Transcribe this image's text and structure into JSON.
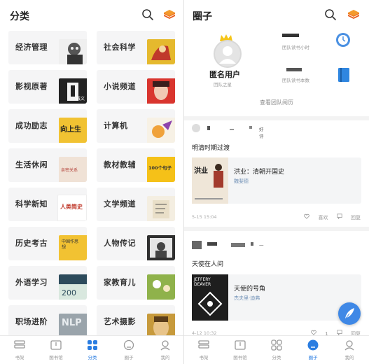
{
  "left": {
    "title": "分类",
    "categories": [
      {
        "label": "经济管理",
        "cover_color": "#efefef"
      },
      {
        "label": "社会科学",
        "cover_color": "#e5b92e"
      },
      {
        "label": "影视原著",
        "cover_color": "#222222"
      },
      {
        "label": "小说频道",
        "cover_color": "#d9352e"
      },
      {
        "label": "成功励志",
        "cover_color": "#f1c232"
      },
      {
        "label": "计算机",
        "cover_color": "#f7f1e5"
      },
      {
        "label": "生活休闲",
        "cover_color": "#f0e2d6"
      },
      {
        "label": "教材教辅",
        "cover_color": "#f5c118"
      },
      {
        "label": "科学新知",
        "cover_color": "#ffffff"
      },
      {
        "label": "文学频道",
        "cover_color": "#f4eee1"
      },
      {
        "label": "历史考古",
        "cover_color": "#f2c232"
      },
      {
        "label": "人物传记",
        "cover_color": "#2f2f2f"
      },
      {
        "label": "外语学习",
        "cover_color": "#d9e8df"
      },
      {
        "label": "家教育儿",
        "cover_color": "#8fb24b"
      },
      {
        "label": "职场进阶",
        "cover_color": "#9aa4ab"
      },
      {
        "label": "艺术摄影",
        "cover_color": "#c79a3c"
      }
    ],
    "cover_texts": {
      "ent_2": "戴文",
      "ent_4": "向上生",
      "ent_6": "亲密关系",
      "ent_7": "100个句子",
      "ent_8": "人类简史",
      "ent_10": "中国作思想",
      "ent_14": "NLP"
    },
    "nav": [
      {
        "label": "书架",
        "icon": "shelf-icon",
        "active": false
      },
      {
        "label": "图书馆",
        "icon": "library-icon",
        "active": false
      },
      {
        "label": "分类",
        "icon": "category-icon",
        "active": true
      },
      {
        "label": "圈子",
        "icon": "circle-icon",
        "active": false
      },
      {
        "label": "我的",
        "icon": "profile-icon",
        "active": false
      }
    ]
  },
  "right": {
    "title": "圈子",
    "team": {
      "name": "匿名用户",
      "subtitle": "团队之星",
      "stat1_label": "团队读书小时",
      "stat2_label": "团队读书本数",
      "view_link": "查看团队阅历"
    },
    "posts": [
      {
        "badge": "好评",
        "text": "明清时期过渡",
        "book_title": "洪业：清朝开国史",
        "book_author": "魏斐德",
        "cover_text": "洪业",
        "time": "5-15 15:04",
        "like_label": "喜欢",
        "reply_label": "回复"
      },
      {
        "badge": "一",
        "text": "天使在人间",
        "book_title": "天使的号角",
        "book_author": "杰夫里·迪弗",
        "cover_text": "JEFFERY DEAVER",
        "time": "4-12 10:32",
        "like_count": "1",
        "reply_label": "回复"
      }
    ],
    "nav": [
      {
        "label": "书架",
        "icon": "shelf-icon",
        "active": false
      },
      {
        "label": "图书馆",
        "icon": "library-icon",
        "active": false
      },
      {
        "label": "分类",
        "icon": "category-icon",
        "active": false
      },
      {
        "label": "圈子",
        "icon": "circle-icon",
        "active": true
      },
      {
        "label": "我的",
        "icon": "profile-icon",
        "active": false
      }
    ]
  },
  "colors": {
    "accent": "#2a7de1",
    "fab": "#3f88e6",
    "logo": "#f07a1e"
  }
}
